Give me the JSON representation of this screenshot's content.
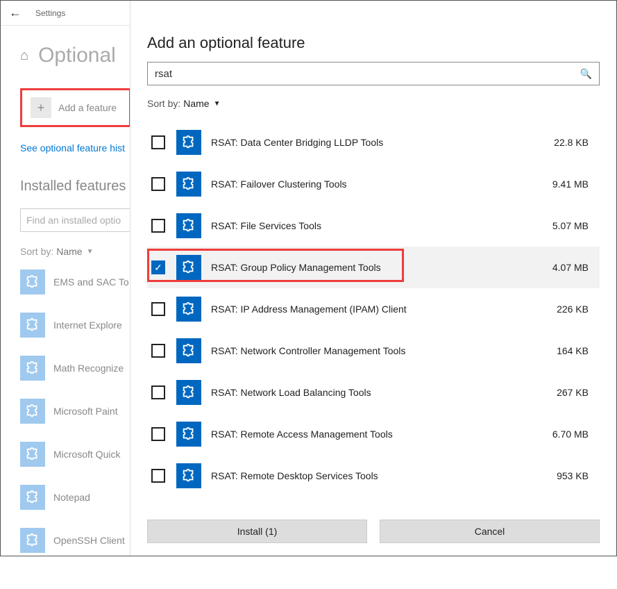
{
  "topbar": {
    "title": "Settings"
  },
  "page": {
    "title": "Optional",
    "add_feature_label": "Add a feature",
    "history_link": "See optional feature hist",
    "installed_heading": "Installed features",
    "installed_search_placeholder": "Find an installed optio",
    "sort_label": "Sort by:",
    "sort_value": "Name",
    "bg_items": [
      "EMS and SAC To",
      "Internet Explore",
      "Math Recognize",
      "Microsoft Paint",
      "Microsoft Quick",
      "Notepad",
      "OpenSSH Client"
    ]
  },
  "panel": {
    "title": "Add an optional feature",
    "search_value": "rsat",
    "sort_label": "Sort by:",
    "sort_value": "Name",
    "install_button": "Install (1)",
    "cancel_button": "Cancel",
    "features": [
      {
        "name": "RSAT: Data Center Bridging LLDP Tools",
        "size": "22.8 KB",
        "checked": false,
        "highlight": false
      },
      {
        "name": "RSAT: Failover Clustering Tools",
        "size": "9.41 MB",
        "checked": false,
        "highlight": false
      },
      {
        "name": "RSAT: File Services Tools",
        "size": "5.07 MB",
        "checked": false,
        "highlight": false
      },
      {
        "name": "RSAT: Group Policy Management Tools",
        "size": "4.07 MB",
        "checked": true,
        "highlight": true
      },
      {
        "name": "RSAT: IP Address Management (IPAM) Client",
        "size": "226 KB",
        "checked": false,
        "highlight": false
      },
      {
        "name": "RSAT: Network Controller Management Tools",
        "size": "164 KB",
        "checked": false,
        "highlight": false
      },
      {
        "name": "RSAT: Network Load Balancing Tools",
        "size": "267 KB",
        "checked": false,
        "highlight": false
      },
      {
        "name": "RSAT: Remote Access Management Tools",
        "size": "6.70 MB",
        "checked": false,
        "highlight": false
      },
      {
        "name": "RSAT: Remote Desktop Services Tools",
        "size": "953 KB",
        "checked": false,
        "highlight": false
      }
    ]
  }
}
